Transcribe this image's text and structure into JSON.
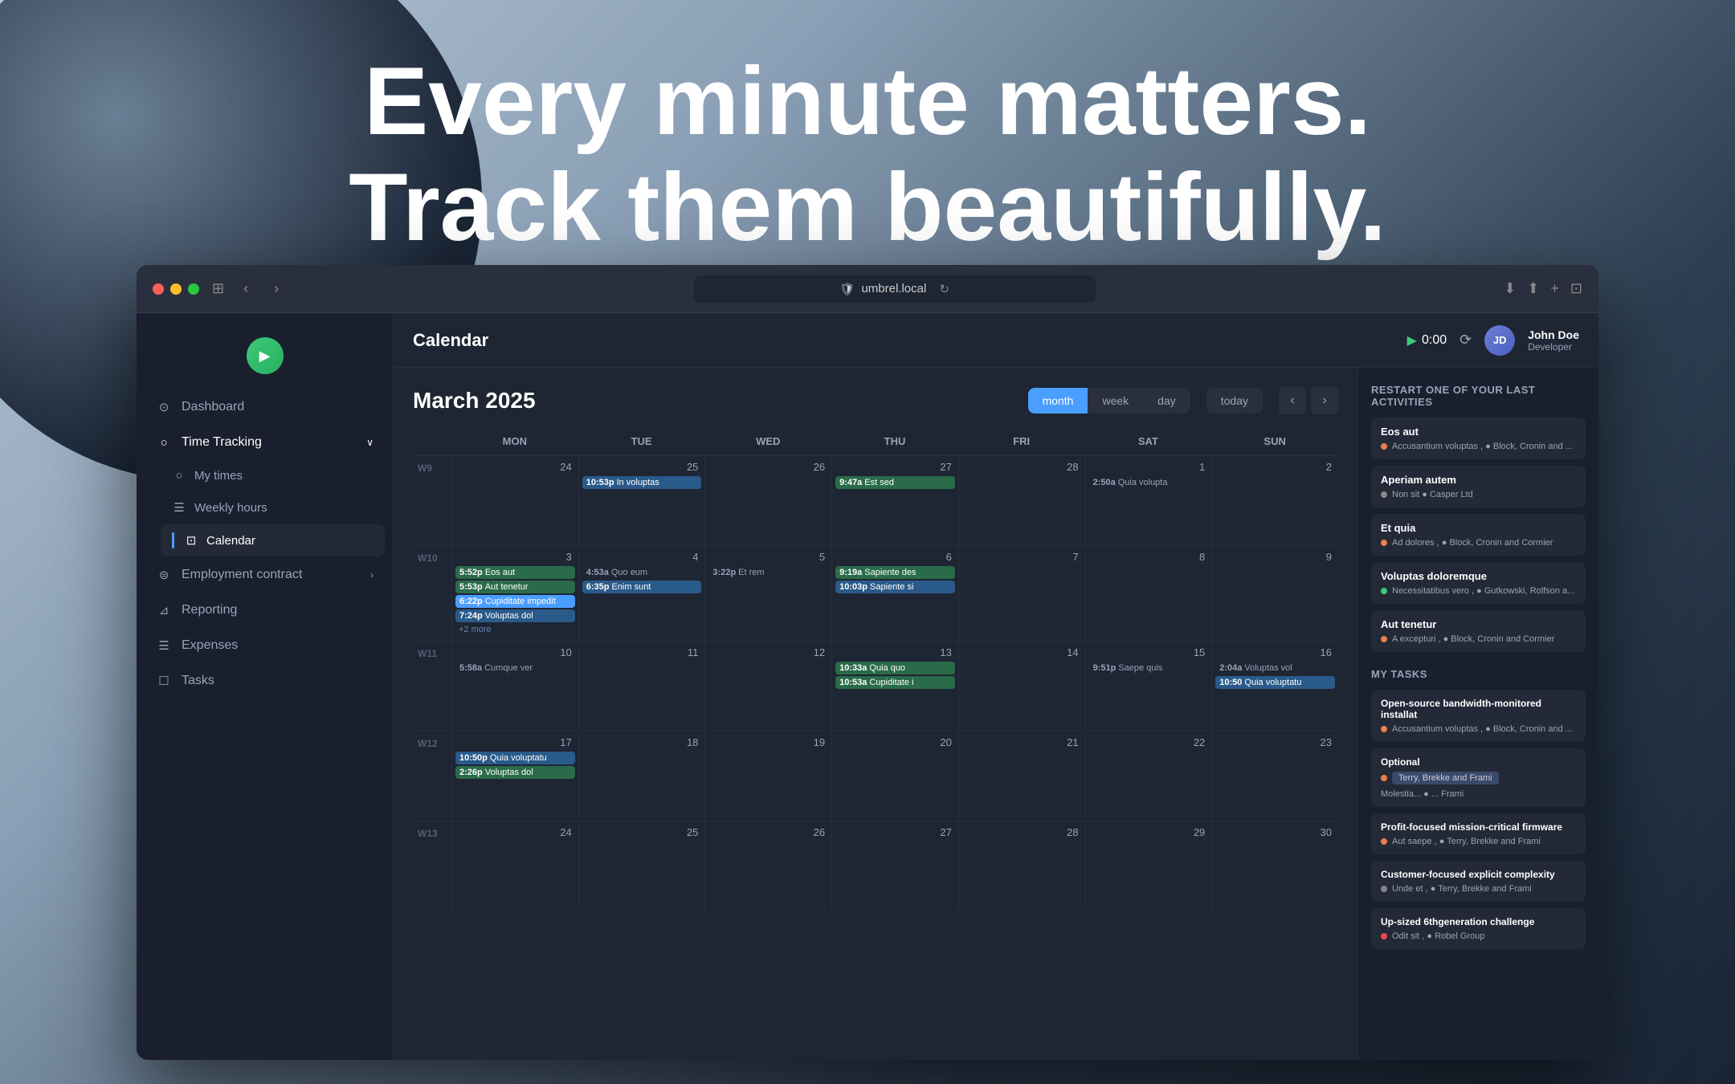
{
  "hero": {
    "line1": "Every minute matters.",
    "line2": "Track them beautifully."
  },
  "browser": {
    "url": "umbrel.local",
    "close_label": "×",
    "minimize_label": "−",
    "maximize_label": "+"
  },
  "sidebar": {
    "logo_alt": "play",
    "items": [
      {
        "id": "dashboard",
        "label": "Dashboard",
        "icon": "⊙"
      },
      {
        "id": "time-tracking",
        "label": "Time Tracking",
        "icon": "○",
        "has_sub": true,
        "expanded": true
      },
      {
        "id": "my-times",
        "label": "My times",
        "icon": "○",
        "sub": true
      },
      {
        "id": "weekly-hours",
        "label": "Weekly hours",
        "icon": "☰",
        "sub": true
      },
      {
        "id": "calendar",
        "label": "Calendar",
        "icon": "⊡",
        "sub": true,
        "active": true
      },
      {
        "id": "employment-contract",
        "label": "Employment contract",
        "icon": "⊜",
        "has_sub": true
      },
      {
        "id": "reporting",
        "label": "Reporting",
        "icon": "⊿"
      },
      {
        "id": "expenses",
        "label": "Expenses",
        "icon": "☰"
      },
      {
        "id": "tasks",
        "label": "Tasks",
        "icon": "☐"
      }
    ]
  },
  "topbar": {
    "title": "Calendar",
    "timer": "0:00",
    "user": {
      "name": "John Doe",
      "role": "Developer",
      "initials": "JD"
    }
  },
  "calendar": {
    "month_year": "March 2025",
    "view_buttons": [
      "month",
      "week",
      "day"
    ],
    "active_view": "month",
    "today_label": "today",
    "day_labels": [
      "Mon",
      "Tue",
      "Wed",
      "Thu",
      "Fri",
      "Sat",
      "Sun"
    ],
    "weeks": [
      {
        "week": "W9",
        "days": [
          {
            "date": 24,
            "events": []
          },
          {
            "date": 25,
            "events": [
              {
                "time": "10:53p",
                "text": "In voluptas",
                "color": "blue"
              }
            ]
          },
          {
            "date": 26,
            "events": []
          },
          {
            "date": 27,
            "events": [
              {
                "time": "9:47a",
                "text": "Est sed",
                "color": "green"
              }
            ]
          },
          {
            "date": 28,
            "events": []
          },
          {
            "date": 1,
            "events": [
              {
                "time": "2:50a",
                "text": "Quia volupta",
                "color": "subtle"
              }
            ]
          },
          {
            "date": 2,
            "events": []
          }
        ]
      },
      {
        "week": "W10",
        "days": [
          {
            "date": 3,
            "events": [
              {
                "time": "5:52p",
                "text": "Eos aut",
                "color": "green"
              },
              {
                "time": "5:53p",
                "text": "Aut tenetur",
                "color": "green"
              },
              {
                "time": "6:22p",
                "text": "Cupiditate impedit",
                "color": "selected"
              },
              {
                "time": "7:24p",
                "text": "Voluptas dol",
                "color": "blue"
              }
            ],
            "more": 2
          },
          {
            "date": 4,
            "events": [
              {
                "time": "4:53a",
                "text": "Quo eum",
                "color": "subtle"
              },
              {
                "time": "6:35p",
                "text": "Enim sunt",
                "color": "blue"
              }
            ]
          },
          {
            "date": 5,
            "events": [
              {
                "time": "3:22p",
                "text": "Et rem",
                "color": "subtle"
              }
            ]
          },
          {
            "date": 6,
            "events": [
              {
                "time": "9:19a",
                "text": "Sapiente des",
                "color": "green"
              },
              {
                "time": "10:03p",
                "text": "Sapiente si",
                "color": "blue"
              }
            ]
          },
          {
            "date": 7,
            "events": []
          },
          {
            "date": 8,
            "events": []
          },
          {
            "date": 9,
            "events": []
          }
        ]
      },
      {
        "week": "W11",
        "days": [
          {
            "date": 10,
            "events": [
              {
                "time": "5:58a",
                "text": "Cumque ver",
                "color": "subtle"
              }
            ]
          },
          {
            "date": 11,
            "events": []
          },
          {
            "date": 12,
            "events": []
          },
          {
            "date": 13,
            "events": [
              {
                "time": "10:33a",
                "text": "Quia quo",
                "color": "green"
              },
              {
                "time": "10:53a",
                "text": "Cupiditate i",
                "color": "green"
              }
            ]
          },
          {
            "date": 14,
            "events": []
          },
          {
            "date": 15,
            "events": [
              {
                "time": "9:51p",
                "text": "Saepe quis",
                "color": "subtle"
              }
            ]
          },
          {
            "date": 16,
            "events": [
              {
                "time": "2:04a",
                "text": "Voluptas vol",
                "color": "subtle"
              },
              {
                "time": "10:50",
                "text": "Quia voluptatu",
                "color": "blue"
              }
            ]
          }
        ]
      },
      {
        "week": "W12",
        "days": [
          {
            "date": 17,
            "events": [
              {
                "time": "10:50p",
                "text": "Quia voluptatu",
                "color": "blue"
              },
              {
                "time": "2:26p",
                "text": "Voluptas dol",
                "color": "green"
              }
            ]
          },
          {
            "date": 18,
            "events": []
          },
          {
            "date": 19,
            "events": []
          },
          {
            "date": 20,
            "events": []
          },
          {
            "date": 21,
            "events": []
          },
          {
            "date": 22,
            "events": []
          },
          {
            "date": 23,
            "events": []
          }
        ]
      },
      {
        "week": "W13",
        "days": [
          {
            "date": 24,
            "events": []
          },
          {
            "date": 25,
            "events": []
          },
          {
            "date": 26,
            "events": []
          },
          {
            "date": 27,
            "events": []
          },
          {
            "date": 28,
            "events": []
          },
          {
            "date": 29,
            "events": []
          },
          {
            "date": 30,
            "events": []
          }
        ]
      }
    ]
  },
  "right_panel": {
    "activities_title": "Restart one of your last activities",
    "activities": [
      {
        "title": "Eos aut",
        "dot1_color": "orange",
        "meta": "Accusantium voluptas , ● Block, Cronin and ..."
      },
      {
        "title": "Aperiam autem",
        "dot1_color": "gray",
        "dot2_color": "red",
        "meta": "Non sit ● Casper Ltd"
      },
      {
        "title": "Et quia",
        "dot1_color": "orange",
        "meta": "Ad dolores , ● Block, Cronin and Cormier"
      },
      {
        "title": "Voluptas doloremque",
        "dot1_color": "green",
        "meta": "Necessitatibus vero , ● Gutkowski, Rolfson a..."
      },
      {
        "title": "Aut tenetur",
        "dot1_color": "orange",
        "meta": "A excepturi , ● Block, Cronin and Cormier"
      }
    ],
    "tasks_title": "My tasks",
    "tasks": [
      {
        "title": "Open-source bandwidth-monitored installat",
        "dot1": "orange",
        "meta": "Accusantium voluptas , ● Block, Cronin and ..."
      },
      {
        "title": "Optional",
        "tooltip": "Terry, Brekke and Frami",
        "dot1": "orange",
        "meta": "Molestia... ● ... Frami"
      },
      {
        "title": "Profit-focused mission-critical firmware",
        "dot1": "orange",
        "meta": "Aut saepe , ● Terry, Brekke and Frami"
      },
      {
        "title": "Customer-focused explicit complexity",
        "dot1": "gray",
        "meta": "Unde et , ● Terry, Brekke and Frami"
      },
      {
        "title": "Up-sized 6thgeneration challenge",
        "dot1": "red",
        "meta": "Odit sit , ● Robel Group"
      }
    ]
  }
}
